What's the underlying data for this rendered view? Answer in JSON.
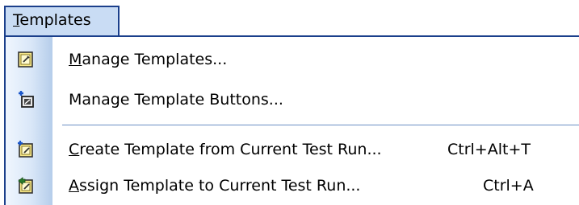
{
  "menu": {
    "title_underlined": "T",
    "title_rest": "emplates",
    "items": [
      {
        "mnemonic": "M",
        "rest": "anage Templates...",
        "shortcut": "",
        "icon": "template-document-icon"
      },
      {
        "mnemonic": "",
        "rest": "Manage Template Buttons...",
        "shortcut": "",
        "icon": "template-button-icon"
      },
      {
        "mnemonic": "C",
        "rest": "reate Template from Current Test Run...",
        "shortcut": "Ctrl+Alt+T",
        "icon": "create-template-icon"
      },
      {
        "mnemonic": "A",
        "rest": "ssign Template to Current Test Run...",
        "shortcut": "Ctrl+A",
        "icon": "assign-template-icon"
      }
    ]
  },
  "colors": {
    "menu_border": "#1b3f8b",
    "menu_tab_bg": "#c9dcf4",
    "gutter_gradient_end": "#b5cdea",
    "separator": "#6b8ec4"
  }
}
